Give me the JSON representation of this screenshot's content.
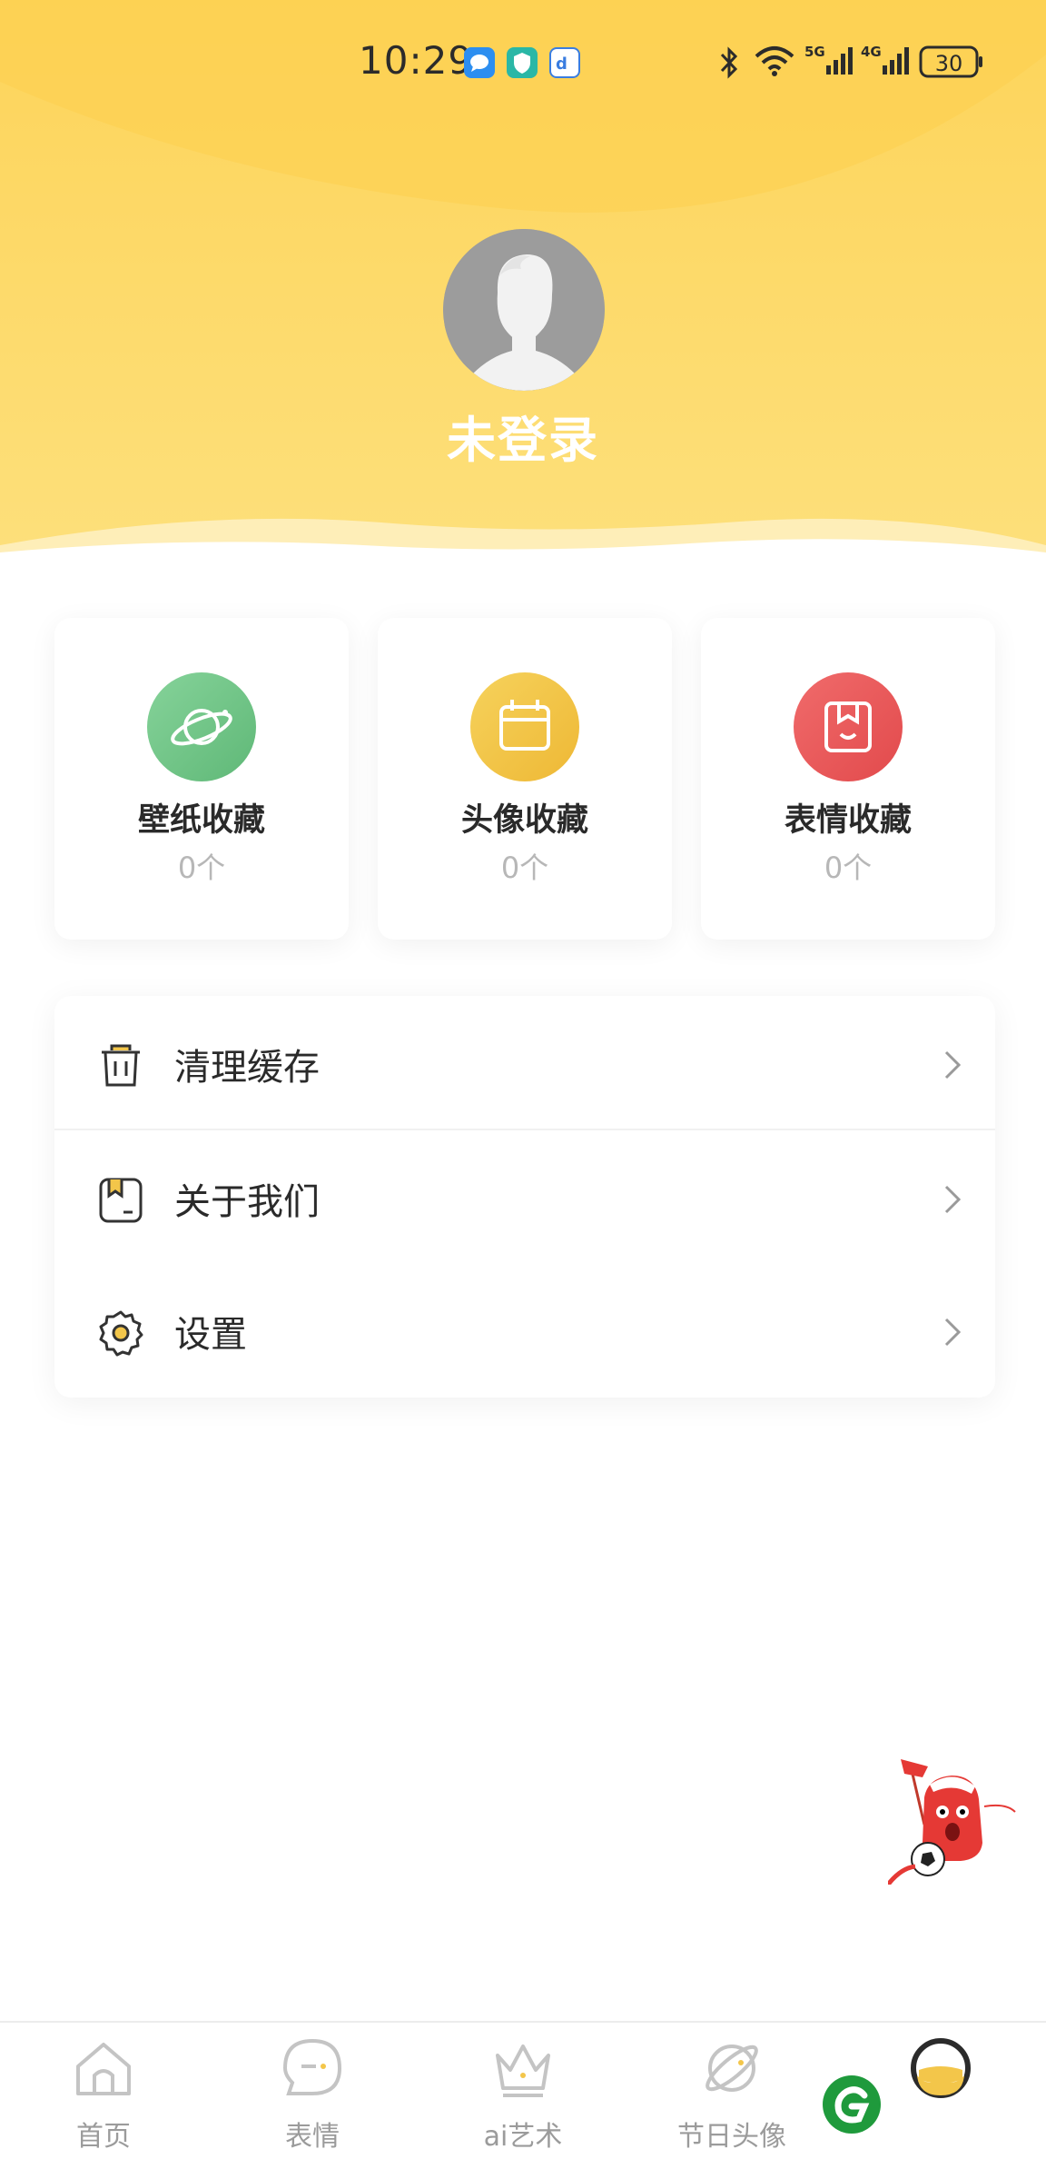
{
  "status_bar": {
    "time": "10:29",
    "battery": "30",
    "network_1": "5G",
    "network_2": "4G",
    "icons": [
      "message-icon",
      "shield-icon",
      "app-icon",
      "bluetooth-icon",
      "wifi-icon",
      "signal-icon",
      "battery-icon"
    ]
  },
  "profile": {
    "name": "未登录",
    "avatar_icon": "default-avatar-icon"
  },
  "favorites": [
    {
      "title": "壁纸收藏",
      "count": "0个",
      "icon": "planet-icon",
      "color": "#7ccb8f"
    },
    {
      "title": "头像收藏",
      "count": "0个",
      "icon": "calendar-icon",
      "color": "#f3c64a"
    },
    {
      "title": "表情收藏",
      "count": "0个",
      "icon": "bookmark-icon",
      "color": "#ec5b5d"
    }
  ],
  "menu": [
    {
      "label": "清理缓存",
      "icon": "trash-icon"
    },
    {
      "label": "关于我们",
      "icon": "info-book-icon"
    },
    {
      "label": "设置",
      "icon": "gear-icon"
    }
  ],
  "bottom_nav": [
    {
      "label": "首页",
      "icon": "home-icon"
    },
    {
      "label": "表情",
      "icon": "emoji-icon"
    },
    {
      "label": "ai艺术",
      "icon": "crown-icon"
    },
    {
      "label": "节日头像",
      "icon": "planet-icon"
    },
    {
      "label": "",
      "icon": "profile-face-icon"
    }
  ],
  "colors": {
    "header_yellow": "#fdd55d",
    "header_yellow_light": "#fce07f",
    "green": "#7ccb8f",
    "yellow": "#f3c64a",
    "red": "#ec5b5d"
  }
}
